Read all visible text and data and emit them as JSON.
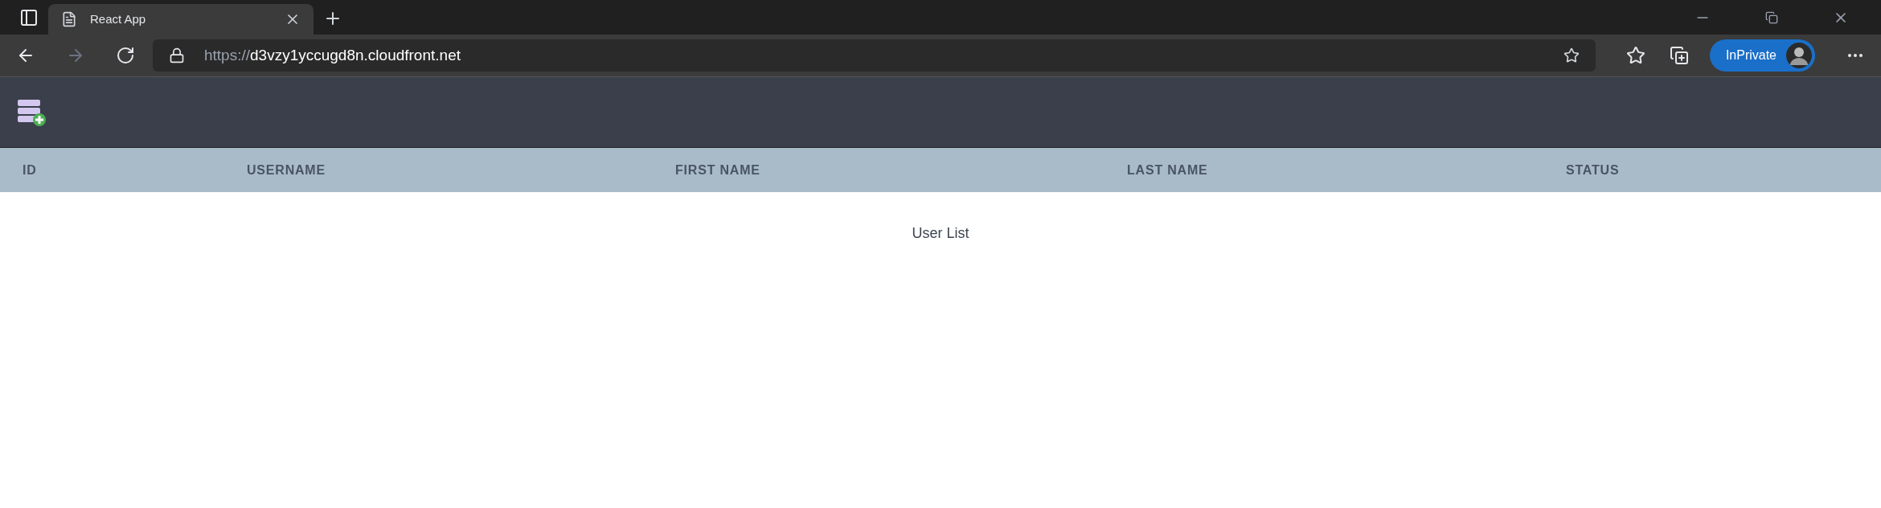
{
  "browser": {
    "tab": {
      "title": "React App",
      "selected": true
    },
    "address": {
      "scheme": "https://",
      "host": "d3vzy1yccugd8n.cloudfront.net"
    },
    "profile": {
      "label": "InPrivate"
    }
  },
  "table": {
    "columns": [
      "ID",
      "USERNAME",
      "FIRST NAME",
      "LAST NAME",
      "STATUS"
    ],
    "caption": "User List"
  }
}
